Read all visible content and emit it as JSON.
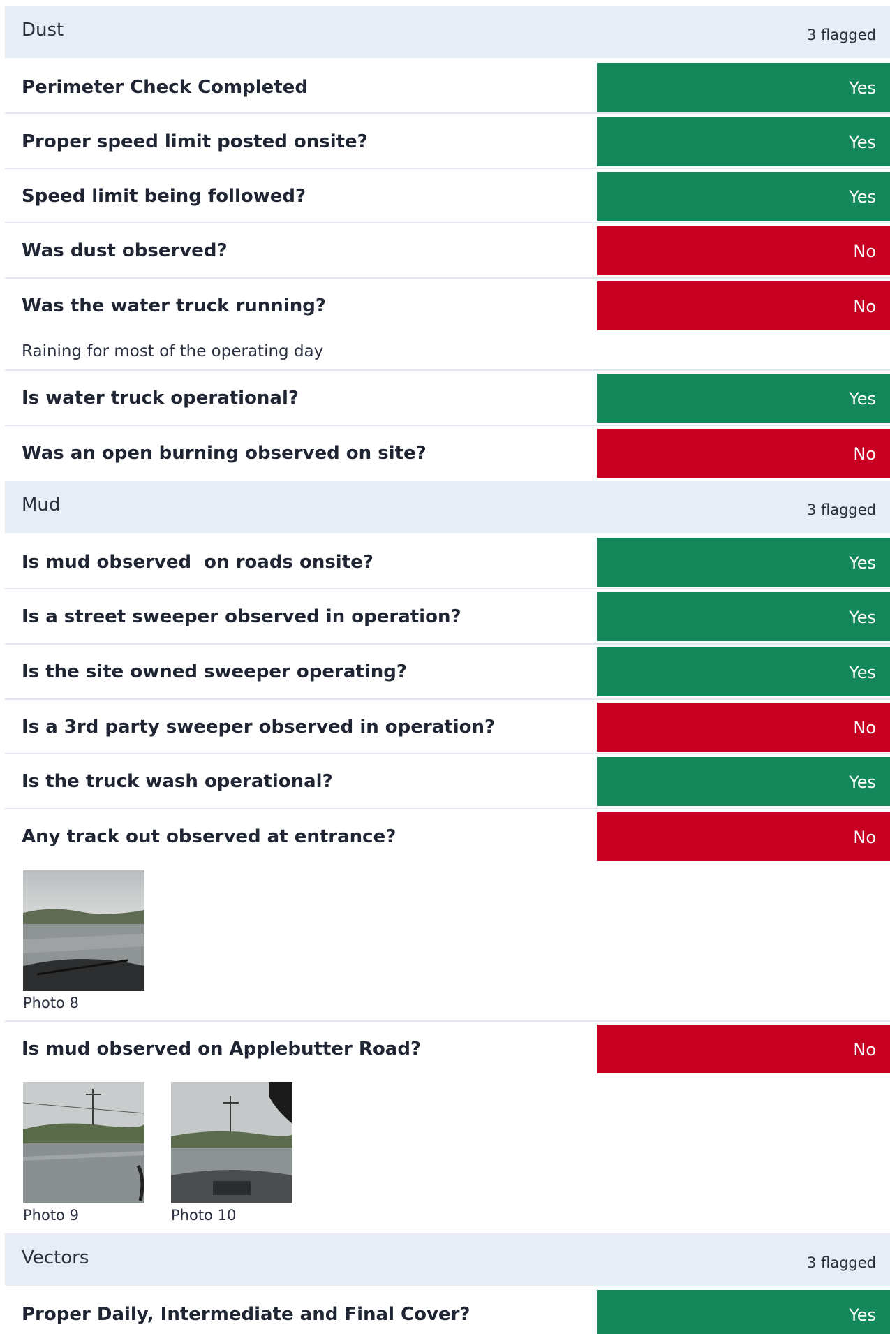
{
  "sections": [
    {
      "title": "Dust",
      "flagged": "3 flagged",
      "questions": [
        {
          "text": "Perimeter Check Completed",
          "answer": "Yes"
        },
        {
          "text": "Proper speed limit posted onsite?",
          "answer": "Yes"
        },
        {
          "text": "Speed limit being followed?",
          "answer": "Yes"
        },
        {
          "text": "Was dust observed?",
          "answer": "No"
        },
        {
          "text": "Was the water truck running?",
          "answer": "No",
          "note": "Raining for most of the operating day"
        },
        {
          "text": "Is water truck operational?",
          "answer": "Yes"
        },
        {
          "text": "Was an open burning observed on site?",
          "answer": "No"
        }
      ]
    },
    {
      "title": "Mud",
      "flagged": "3 flagged",
      "questions": [
        {
          "text": "Is mud observed  on roads onsite?",
          "answer": "Yes"
        },
        {
          "text": "Is a street sweeper observed in operation?",
          "answer": "Yes"
        },
        {
          "text": "Is the site owned sweeper operating?",
          "answer": "Yes"
        },
        {
          "text": "Is a 3rd party sweeper observed in operation?",
          "answer": "No"
        },
        {
          "text": "Is the truck wash operational?",
          "answer": "Yes"
        },
        {
          "text": "Any track out observed at entrance?",
          "answer": "No",
          "photos": [
            "Photo 8"
          ]
        },
        {
          "text": "Is mud observed on Applebutter Road?",
          "answer": "No",
          "photos": [
            "Photo 9",
            "Photo 10"
          ]
        }
      ]
    },
    {
      "title": "Vectors",
      "flagged": "3 flagged",
      "questions": [
        {
          "text": "Proper Daily, Intermediate and Final Cover?",
          "answer": "Yes"
        }
      ]
    }
  ],
  "colors": {
    "yes": "#14875b",
    "no": "#c80022",
    "section_bg": "#e8ecf4"
  },
  "icons": [
    "photo-thumbnail"
  ]
}
